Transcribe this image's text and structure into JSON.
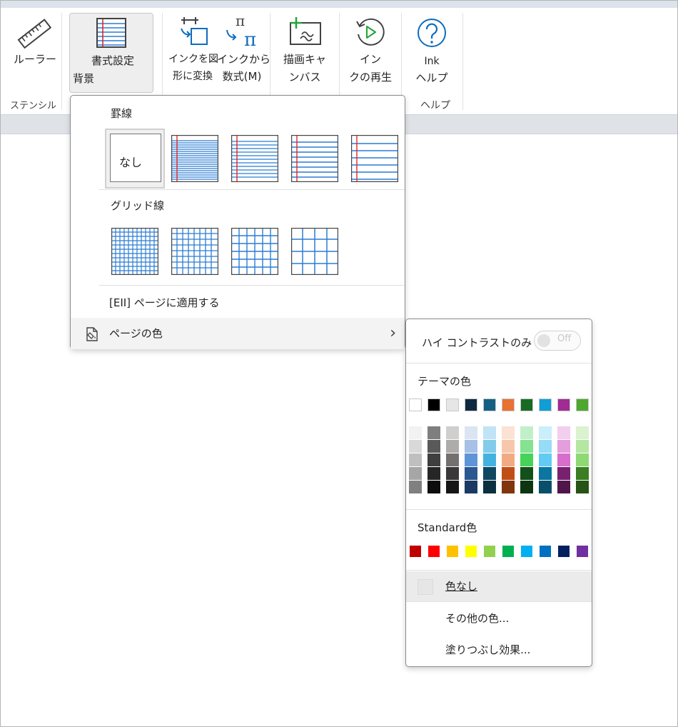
{
  "ribbon": {
    "ruler_label": "ルーラー",
    "stencil_group": "ステンシル",
    "background_line1": "書式設定",
    "background_line2": "背景",
    "ink_to_shape_line1": "インクを図",
    "ink_to_shape_line2": "形に変換",
    "ink_to_math_line1": "インクから",
    "ink_to_math_line2": "数式(M)",
    "canvas_line1": "描画キャ",
    "canvas_line2": "ンバス",
    "replay_line1": "イン",
    "replay_line2": "クの再生",
    "help_line1": "Ink",
    "help_line2": "ヘルプ",
    "help_group": "ヘルプ",
    "pi_symbol": "π"
  },
  "menu": {
    "rule_lines_header": "罫線",
    "none_label": "なし",
    "grid_lines_header": "グリッド線",
    "apply_all": "[EII] ページに適用する",
    "page_color": "ページの色",
    "chevron": "›"
  },
  "submenu": {
    "high_contrast": "ハイ コントラストのみ",
    "toggle_state": "Off",
    "theme_colors_header": "テーマの色",
    "standard_colors_header": "Standard色",
    "no_color": "色なし",
    "more_colors": "その他の色...",
    "fill_effects": "塗りつぶし効果..."
  },
  "colors": {
    "rule_blue": "#2b7cd3",
    "margin_red": "#e0262b",
    "accent_blue": "#0f6cbd",
    "plus_green": "#23a33a",
    "theme_row": [
      "#ffffff",
      "#000000",
      "#e7e6e6",
      "#0e2841",
      "#156082",
      "#e97132",
      "#196b24",
      "#0f9ed5",
      "#a02b93",
      "#4ea72e"
    ],
    "theme_shades": [
      [
        "#f2f2f2",
        "#d9d9d9",
        "#bfbfbf",
        "#a6a6a6",
        "#808080"
      ],
      [
        "#7f7f7f",
        "#595959",
        "#3f3f3f",
        "#262626",
        "#0d0d0d"
      ],
      [
        "#d0cece",
        "#aeabab",
        "#757070",
        "#3a3838",
        "#171616"
      ],
      [
        "#dbe5f1",
        "#a7c1e6",
        "#5f95d6",
        "#2b5891",
        "#1a3a64"
      ],
      [
        "#c0e4f5",
        "#83cbeb",
        "#44b2e1",
        "#104862",
        "#0b3041"
      ],
      [
        "#fbe2d5",
        "#f7c7ac",
        "#f2aa84",
        "#c04f15",
        "#80350e"
      ],
      [
        "#c1f0c8",
        "#84e291",
        "#47d35a",
        "#13501b",
        "#0d3512"
      ],
      [
        "#caeefb",
        "#95dcf7",
        "#61cbf3",
        "#0b769f",
        "#074f6a"
      ],
      [
        "#f2ceef",
        "#e59edd",
        "#d86dcd",
        "#782170",
        "#50164b"
      ],
      [
        "#daf2d0",
        "#b5e6a2",
        "#8ed973",
        "#3b7d23",
        "#275317"
      ]
    ],
    "standard_row": [
      "#c00000",
      "#ff0000",
      "#ffc000",
      "#ffff00",
      "#92d050",
      "#00b050",
      "#00b0f0",
      "#0070c0",
      "#002060",
      "#7030a0"
    ]
  }
}
